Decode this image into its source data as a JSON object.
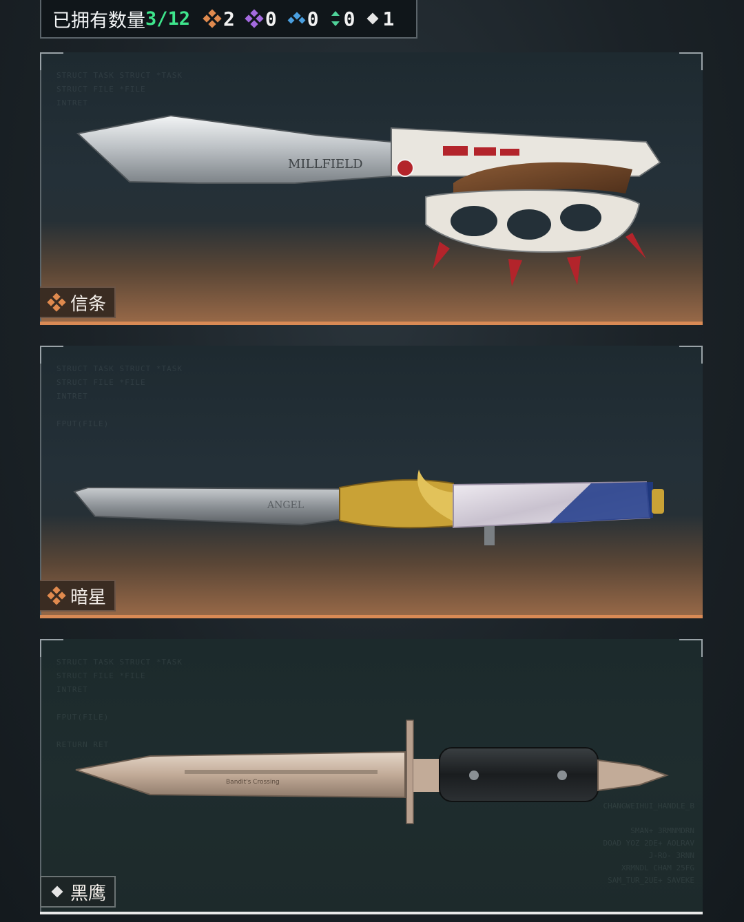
{
  "summary": {
    "label": "已拥有数量",
    "count": "3/12",
    "rarities": [
      {
        "icon": "orange-diamond-cluster-icon",
        "color": "#e08a4e",
        "value": "2"
      },
      {
        "icon": "purple-diamond-cluster-icon",
        "color": "#a46ae0",
        "value": "0"
      },
      {
        "icon": "blue-diamond-pair-icon",
        "color": "#4a9fe0",
        "value": "0"
      },
      {
        "icon": "green-chevron-pair-icon",
        "color": "#4fd39a",
        "value": "0"
      },
      {
        "icon": "white-diamond-icon",
        "color": "#e6e6e6",
        "value": "1"
      }
    ]
  },
  "cards": [
    {
      "name": "信条",
      "rarity": "orange",
      "accent": "#d98a55",
      "weapon_icon": "knuckle-knife-icon",
      "blade_text": "MILLFIELD"
    },
    {
      "name": "暗星",
      "rarity": "orange",
      "accent": "#d98a55",
      "weapon_icon": "eagle-dagger-icon",
      "blade_text": "ANGEL"
    },
    {
      "name": "黑鹰",
      "rarity": "white",
      "accent": "#e9e9e9",
      "weapon_icon": "bayonet-icon",
      "blade_text": "Bandit's Crossing"
    }
  ]
}
